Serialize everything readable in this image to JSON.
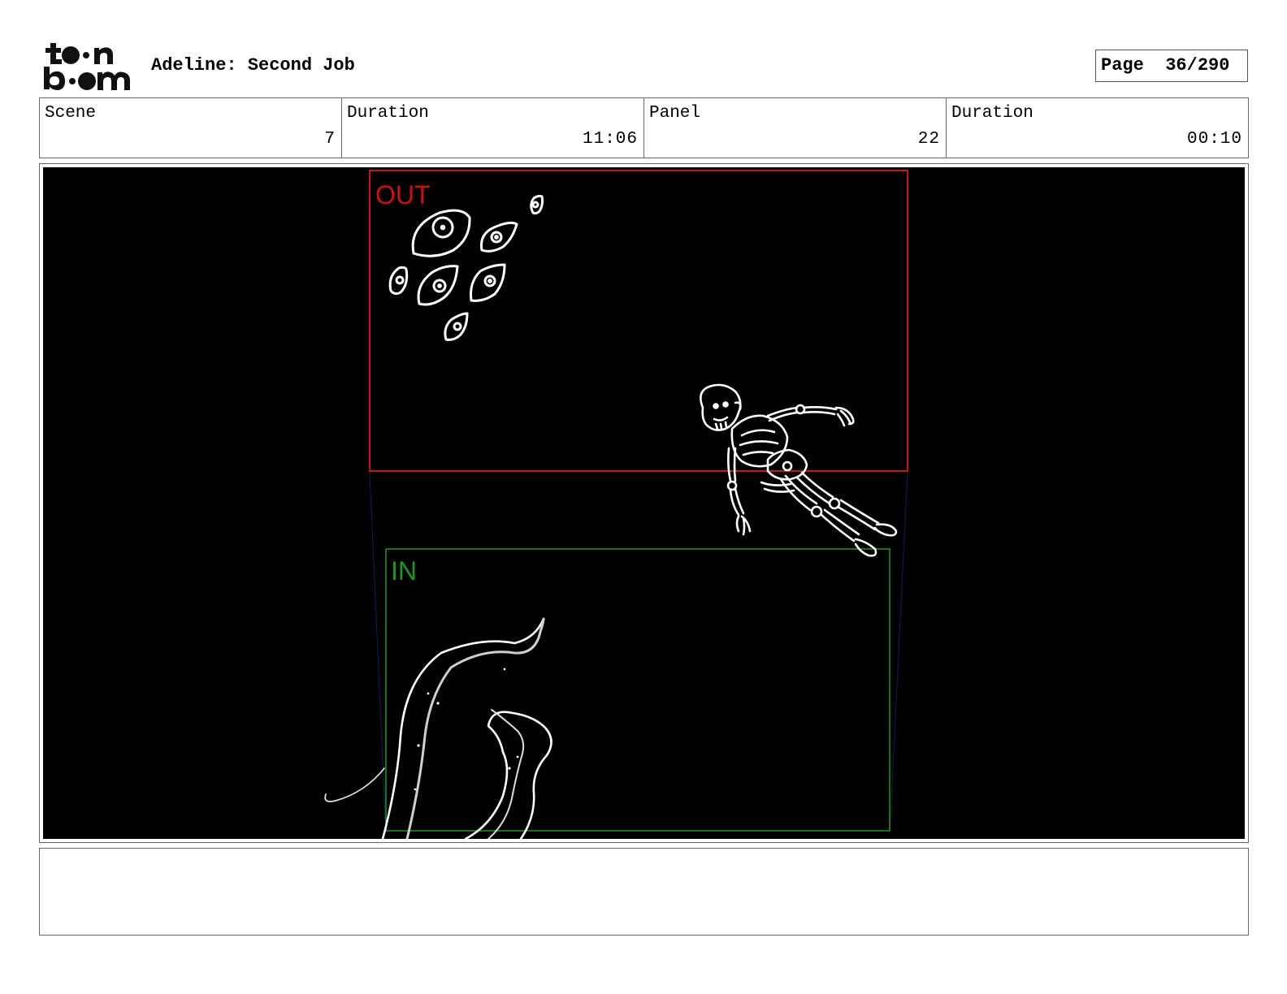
{
  "header": {
    "logo_text": "toonboom",
    "project_title": "Adeline: Second Job",
    "page_label": "Page",
    "page_value": "36/290"
  },
  "info": {
    "scene_label": "Scene",
    "scene_value": "7",
    "scene_duration_label": "Duration",
    "scene_duration_value": "11:06",
    "panel_label": "Panel",
    "panel_value": "22",
    "panel_duration_label": "Duration",
    "panel_duration_value": "00:10"
  },
  "frame": {
    "background": "#000000",
    "out_frame_label": "OUT",
    "out_frame_color": "#cc1111",
    "in_frame_label": "IN",
    "in_frame_color": "#1a9a1a",
    "sketch_color": "#ffffff"
  },
  "notes": {
    "text": ""
  }
}
